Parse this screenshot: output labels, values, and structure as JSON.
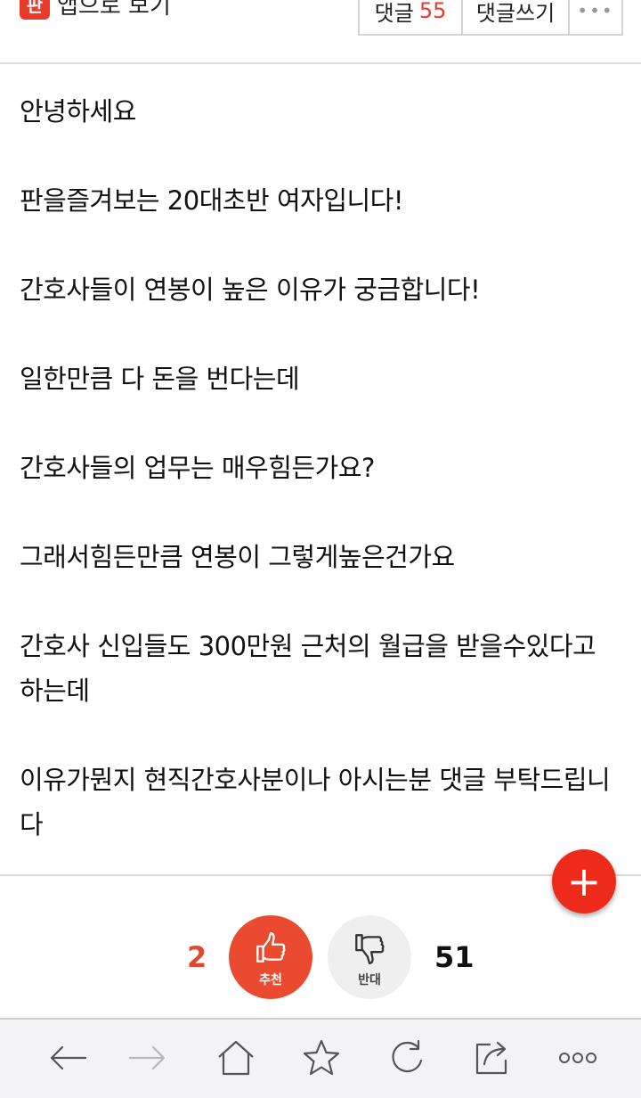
{
  "topbar": {
    "app_logo_text": "판",
    "app_link_label": "앱으로 보기",
    "comments_label": "댓글",
    "comments_count": "55",
    "write_comment_label": "댓글쓰기",
    "more_label": "•••"
  },
  "article": {
    "paragraphs": [
      "안녕하세요",
      "판을즐겨보는 20대초반 여자입니다!",
      "간호사들이 연봉이 높은 이유가 궁금합니다!",
      "일한만큼 다 돈을 번다는데",
      "간호사들의 업무는 매우힘든가요?",
      "그래서힘든만큼 연봉이 그렇게높은건가요",
      "간호사 신입들도 300만원 근처의 월급을 받을수있다고 하는데",
      "이유가뭔지 현직간호사분이나 아시는분 댓글 부탁드립니다"
    ]
  },
  "fab": {
    "label": "+"
  },
  "vote": {
    "upvote_count": "2",
    "upvote_label": "추천",
    "downvote_label": "반대",
    "downvote_count": "51"
  },
  "colors": {
    "accent": "#ea3a2b",
    "upvote": "#ea4a30",
    "downvote_bg": "#efefef"
  },
  "bottombar": {
    "icons": [
      "back-arrow-icon",
      "forward-arrow-icon",
      "home-icon",
      "bookmark-star-icon",
      "refresh-icon",
      "share-icon",
      "more-icon"
    ]
  }
}
